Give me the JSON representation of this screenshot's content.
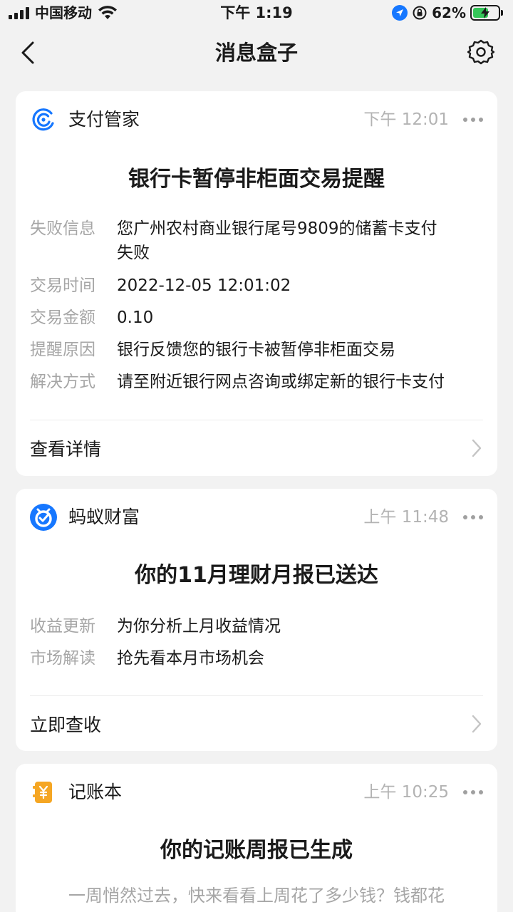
{
  "status_bar": {
    "carrier": "中国移动",
    "time": "下午 1:19",
    "battery": "62%",
    "battery_level": 0.62
  },
  "nav": {
    "title": "消息盒子",
    "back_icon": "back-chevron-icon",
    "settings_icon": "gear-icon"
  },
  "cards": [
    {
      "app_name": "支付管家",
      "time": "下午 12:01",
      "title": "银行卡暂停非柜面交易提醒",
      "rows": [
        {
          "label": "失败信息",
          "value_line1": "您广州农村商业银行尾号9809的储蓄卡支付",
          "value_line2": "失败"
        },
        {
          "label": "交易时间",
          "value": "2022-12-05 12:01:02"
        },
        {
          "label": "交易金额",
          "value": "0.10"
        },
        {
          "label": "提醒原因",
          "value": "银行反馈您的银行卡被暂停非柜面交易"
        },
        {
          "label": "解决方式",
          "value": "请至附近银行网点咨询或绑定新的银行卡支付"
        }
      ],
      "link": "查看详情",
      "accent": "#1677ff"
    },
    {
      "app_name": "蚂蚁财富",
      "time": "上午 11:48",
      "title": "你的11月理财月报已送达",
      "rows": [
        {
          "label": "收益更新",
          "value": "为你分析上月收益情况"
        },
        {
          "label": "市场解读",
          "value": "抢先看本月市场机会"
        }
      ],
      "link": "立即查收",
      "accent": "#1677ff"
    },
    {
      "app_name": "记账本",
      "time": "上午 10:25",
      "title": "你的记账周报已生成",
      "summary": "一周悄然过去，快来看看上周花了多少钱？钱都花",
      "accent": "#f5a623"
    }
  ]
}
